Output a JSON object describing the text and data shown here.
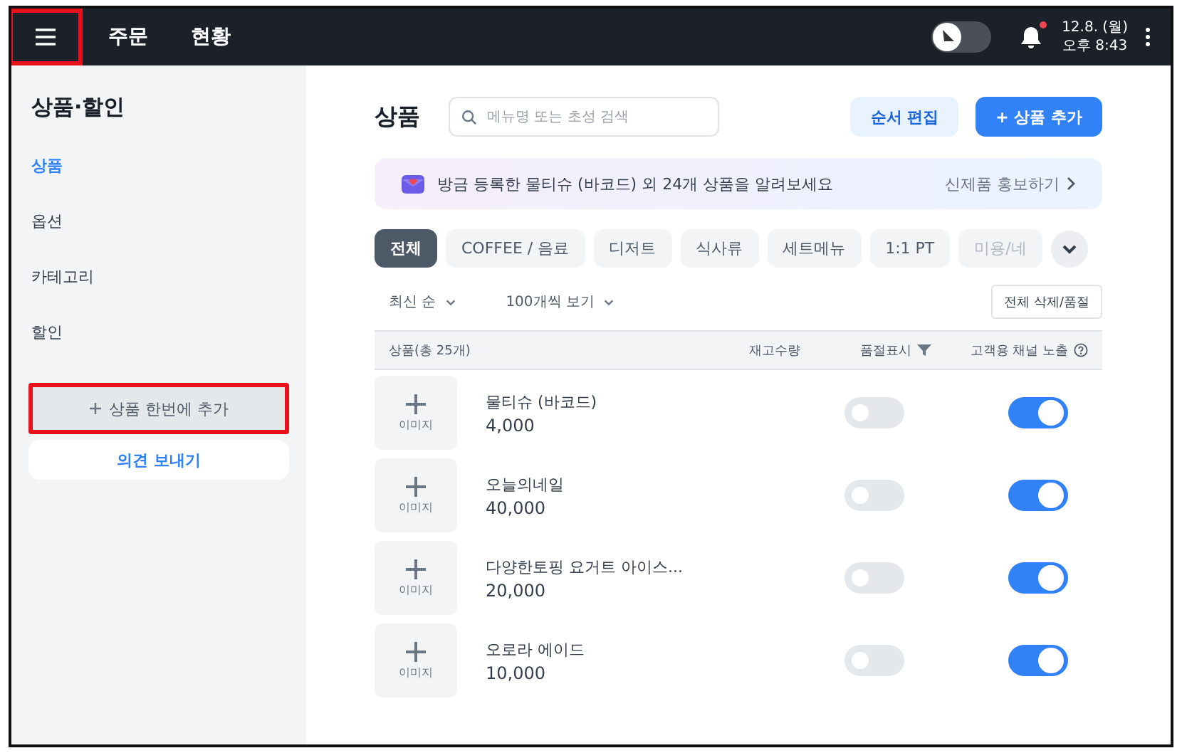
{
  "topbar": {
    "menu_highlighted": true,
    "nav": [
      {
        "label": "주문"
      },
      {
        "label": "현황"
      }
    ],
    "theme_toggle_on": false,
    "notification_dot": true,
    "date": "12.8. (월)",
    "time": "오후 8:43"
  },
  "sidebar": {
    "title": "상품·할인",
    "items": [
      {
        "label": "상품",
        "selected": true
      },
      {
        "label": "옵션",
        "selected": false
      },
      {
        "label": "카테고리",
        "selected": false
      },
      {
        "label": "할인",
        "selected": false
      }
    ],
    "bulk_add": {
      "label": "상품 한번에 추가",
      "highlighted": true
    },
    "feedback": "의견 보내기"
  },
  "main": {
    "title": "상품",
    "search": {
      "placeholder": "메뉴명 또는 초성 검색"
    },
    "reorder_button": "순서 편집",
    "add_button": "+ 상품 추가",
    "banner": {
      "text": "방금 등록한 물티슈 (바코드) 외 24개  상품을 알려보세요",
      "link": "신제품 홍보하기"
    },
    "tabs": [
      {
        "label": "전체",
        "selected": true
      },
      {
        "label": "COFFEE / 음료",
        "selected": false
      },
      {
        "label": "디저트",
        "selected": false
      },
      {
        "label": "식사류",
        "selected": false
      },
      {
        "label": "세트메뉴",
        "selected": false
      },
      {
        "label": "1:1 PT",
        "selected": false
      },
      {
        "label": "미용/네",
        "selected": false
      }
    ],
    "sort": "최신 순",
    "page_size": "100개씩 보기",
    "bulk_button": "전체 삭제/품절",
    "table": {
      "columns": [
        "상품(총 25개)",
        "재고수량",
        "품절표시",
        "고객용 채널 노출"
      ],
      "rows": [
        {
          "image_label": "이미지",
          "name": "물티슈 (바코드)",
          "price": "4,000",
          "sold_out": false,
          "channel_visible": true
        },
        {
          "image_label": "이미지",
          "name": "오늘의네일",
          "price": "40,000",
          "sold_out": false,
          "channel_visible": true
        },
        {
          "image_label": "이미지",
          "name": "다양한토핑 요거트 아이스...",
          "price": "20,000",
          "sold_out": false,
          "channel_visible": true
        },
        {
          "image_label": "이미지",
          "name": "오로라 에이드",
          "price": "10,000",
          "sold_out": false,
          "channel_visible": true
        }
      ]
    }
  }
}
